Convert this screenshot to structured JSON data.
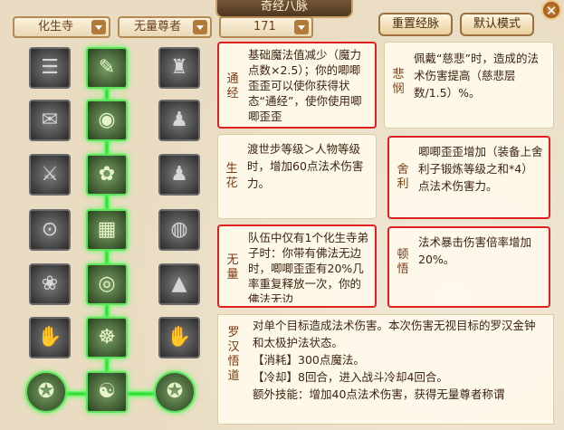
{
  "window": {
    "title": "奇经八脉",
    "close_icon": "close-icon"
  },
  "toolbar": {
    "sect": "化生寺",
    "school": "无量尊者",
    "points": "171",
    "reset_label": "重置经脉",
    "default_label": "默认模式"
  },
  "skills": [
    {
      "name": "通经",
      "text": "基础魔法值减少（魔力点数×2.5）；你的唧唧歪歪可以使你获得状态“通经”，使你使用唧唧歪歪",
      "selected": true
    },
    {
      "name": "悲悯",
      "text": "佩戴“慈悲”时，造成的法术伤害提高（慈悲层数/1.5）%。",
      "selected": false
    },
    {
      "name": "生花",
      "text": "渡世步等级＞人物等级时，增加60点法术伤害力。",
      "selected": false
    },
    {
      "name": "舍利",
      "text": "唧唧歪歪增加（装备上舍利子锻炼等级之和*4）点法术伤害力。",
      "selected": true
    },
    {
      "name": "无量",
      "text": "队伍中仅有1个化生寺弟子时：你带有佛法无边时，唧唧歪歪有20%几率重复释放一次，你的佛法无边",
      "selected": true
    },
    {
      "name": "顿悟",
      "text": "法术暴击伤害倍率增加20%。",
      "selected": true
    }
  ],
  "detail": {
    "name": "罗汉悟道",
    "lines": [
      "对单个目标造成法术伤害。本次伤害无视目标的罗汉金钟和太极护法状态。",
      "【消耗】300点魔法。",
      "【冷却】8回合，进入战斗冷却4回合。",
      "额外技能：增加40点法术伤害，获得无量尊者称谓"
    ]
  },
  "nodes": [
    [
      "book-icon",
      "brush-icon",
      "figure-icon"
    ],
    [
      "scroll-icon",
      "eye-icon",
      "figure-icon"
    ],
    [
      "blade-icon",
      "flower-icon",
      "figure-icon"
    ],
    [
      "ring-icon",
      "altar-icon",
      "stone-icon"
    ],
    [
      "lotus-icon",
      "wave-icon",
      "stupa-icon"
    ],
    [
      "hand-icon",
      "meditate-icon",
      "hand-icon"
    ],
    [
      "coin-icon",
      "meditate-icon",
      "coin-icon"
    ]
  ]
}
